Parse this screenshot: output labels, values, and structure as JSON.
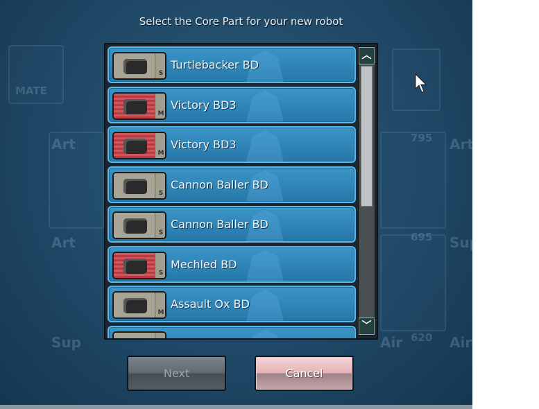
{
  "dialog": {
    "title": "Select the Core Part for your new robot",
    "items": [
      {
        "name": "Turtlebacker BD",
        "grade": "S",
        "color": "gray"
      },
      {
        "name": "Victory BD3",
        "grade": "M",
        "color": "red"
      },
      {
        "name": "Victory BD3",
        "grade": "M",
        "color": "red"
      },
      {
        "name": "Cannon Baller BD",
        "grade": "S",
        "color": "gray"
      },
      {
        "name": "Cannon Baller BD",
        "grade": "S",
        "color": "gray"
      },
      {
        "name": "Mechled BD",
        "grade": "S",
        "color": "red"
      },
      {
        "name": "Assault Ox BD",
        "grade": "M",
        "color": "gray"
      },
      {
        "name": "",
        "grade": "",
        "color": "gray"
      }
    ],
    "scroll_up": "▲",
    "scroll_down": "▼",
    "next_label": "Next",
    "cancel_label": "Cancel"
  },
  "background": {
    "mate": "MATE",
    "labels": [
      "Art",
      "Art",
      "Art",
      "Sup",
      "Air",
      "Sup",
      "Air",
      "795",
      "695",
      "620"
    ]
  },
  "colors": {
    "row": "#2f87b9",
    "cancel": "#e4b3b6",
    "next": "#626a71"
  }
}
